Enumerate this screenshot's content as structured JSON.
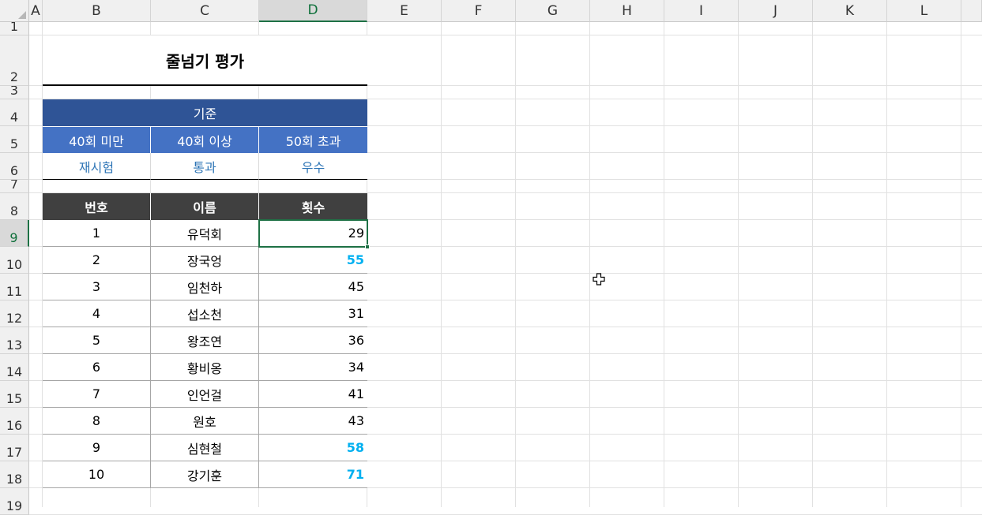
{
  "columns": [
    "A",
    "B",
    "C",
    "D",
    "E",
    "F",
    "G",
    "H",
    "I",
    "J",
    "K",
    "L"
  ],
  "rows": [
    "1",
    "2",
    "3",
    "4",
    "5",
    "6",
    "7",
    "8",
    "9",
    "10",
    "11",
    "12",
    "13",
    "14",
    "15",
    "16",
    "17",
    "18",
    "19"
  ],
  "selected": {
    "column": "D",
    "row": "9"
  },
  "sheet": {
    "title": "줄넘기 평가",
    "criteria": {
      "header": "기준",
      "thresholds": [
        "40회 미만",
        "40회 이상",
        "50회 초과"
      ],
      "results": [
        "재시험",
        "통과",
        "우수"
      ]
    },
    "table": {
      "headers": [
        "번호",
        "이름",
        "횟수"
      ],
      "rows": [
        {
          "no": "1",
          "name": "유덕회",
          "count": "29",
          "highlight": false
        },
        {
          "no": "2",
          "name": "장국엉",
          "count": "55",
          "highlight": true
        },
        {
          "no": "3",
          "name": "임천하",
          "count": "45",
          "highlight": false
        },
        {
          "no": "4",
          "name": "섭소천",
          "count": "31",
          "highlight": false
        },
        {
          "no": "5",
          "name": "왕조연",
          "count": "36",
          "highlight": false
        },
        {
          "no": "6",
          "name": "황비옹",
          "count": "34",
          "highlight": false
        },
        {
          "no": "7",
          "name": "인언걸",
          "count": "41",
          "highlight": false
        },
        {
          "no": "8",
          "name": "원호",
          "count": "43",
          "highlight": false
        },
        {
          "no": "9",
          "name": "심현철",
          "count": "58",
          "highlight": true
        },
        {
          "no": "10",
          "name": "강기훈",
          "count": "71",
          "highlight": true
        }
      ]
    }
  },
  "colors": {
    "criteria_header_bg": "#2f5496",
    "criteria_sub_bg": "#4472c4",
    "result_text": "#2e75b6",
    "table_header_bg": "#404040",
    "highlight_text": "#00b0f0",
    "selection_border": "#1e7145"
  },
  "cursor_icon": "cell-select-cross-icon"
}
